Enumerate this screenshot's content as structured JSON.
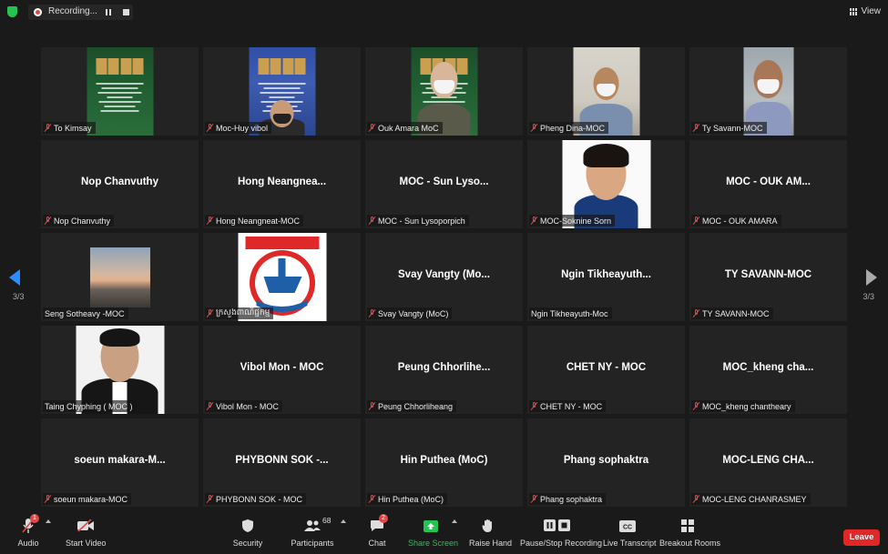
{
  "topbar": {
    "recording_label": "Recording...",
    "view_label": "View"
  },
  "pager": {
    "left": "3/3",
    "right": "3/3"
  },
  "tiles": [
    {
      "label": "To Kimsay",
      "muted": true,
      "type": "video",
      "kind": "banner"
    },
    {
      "label": "Moc-Huy vibol",
      "muted": true,
      "type": "video",
      "kind": "bannerperson"
    },
    {
      "label": "Ouk Amara MoC",
      "muted": true,
      "type": "video",
      "kind": "greenperson"
    },
    {
      "label": "Pheng Dina-MOC",
      "muted": true,
      "type": "video",
      "kind": "office"
    },
    {
      "label": "Ty Savann-MOC",
      "muted": true,
      "type": "video",
      "kind": "wall"
    },
    {
      "big": "Nop Chanvuthy",
      "label": "Nop Chanvuthy",
      "muted": true,
      "type": "name"
    },
    {
      "big": "Hong Neangnea...",
      "label": "Hong Neangneat-MOC",
      "muted": true,
      "type": "name"
    },
    {
      "big": "MOC - Sun Lyso...",
      "label": "MOC - Sun Lysoporpich",
      "muted": true,
      "type": "name"
    },
    {
      "label": "MOC-Soknine Sorn",
      "muted": true,
      "type": "video",
      "kind": "woman"
    },
    {
      "big": "MOC - OUK AM...",
      "label": "MOC - OUK AMARA",
      "muted": true,
      "type": "name"
    },
    {
      "label": "Seng Sotheavy -MOC",
      "muted": false,
      "type": "video",
      "kind": "sunset"
    },
    {
      "label": "ក្រសួងពាណិជ្ជកម្ម",
      "muted": true,
      "type": "video",
      "kind": "logo"
    },
    {
      "big": "Svay Vangty (Mo...",
      "label": "Svay Vangty (MoC)",
      "muted": true,
      "type": "name"
    },
    {
      "big": "Ngin Tikheayuth...",
      "label": "Ngin Tikheayuth-Moc",
      "muted": false,
      "type": "name"
    },
    {
      "big": "TY SAVANN-MOC",
      "label": "TY SAVANN-MOC",
      "muted": true,
      "type": "name"
    },
    {
      "label": "Taing Chyphing ( MOC )",
      "muted": false,
      "type": "video",
      "kind": "portrait"
    },
    {
      "big": "Vibol Mon - MOC",
      "label": "Vibol Mon - MOC",
      "muted": true,
      "type": "name"
    },
    {
      "big": "Peung Chhorlihe...",
      "label": "Peung Chhorliheang",
      "muted": true,
      "type": "name"
    },
    {
      "big": "CHET NY - MOC",
      "label": "CHET NY - MOC",
      "muted": true,
      "type": "name"
    },
    {
      "big": "MOC_kheng cha...",
      "label": "MOC_kheng chantheary",
      "muted": true,
      "type": "name"
    },
    {
      "big": "soeun makara-M...",
      "label": "soeun makara-MOC",
      "muted": true,
      "type": "name"
    },
    {
      "big": "PHYBONN SOK -...",
      "label": "PHYBONN SOK - MOC",
      "muted": true,
      "type": "name"
    },
    {
      "big": "Hin Puthea (MoC)",
      "label": "Hin Puthea (MoC)",
      "muted": true,
      "type": "name"
    },
    {
      "big": "Phang sophaktra",
      "label": "Phang sophaktra",
      "muted": true,
      "type": "name"
    },
    {
      "big": "MOC-LENG CHA...",
      "label": "MOC-LENG CHANRASMEY",
      "muted": true,
      "type": "name"
    }
  ],
  "toolbar": {
    "audio": "Audio",
    "audio_badge": "1",
    "start_video": "Start Video",
    "security": "Security",
    "participants": "Participants",
    "participants_count": "68",
    "chat": "Chat",
    "chat_badge": "2",
    "share_screen": "Share Screen",
    "raise_hand": "Raise Hand",
    "pause_stop_recording": "Pause/Stop Recording",
    "live_transcript": "Live Transcript",
    "breakout_rooms": "Breakout Rooms",
    "leave": "Leave"
  },
  "colors": {
    "accent": "#2d8cff",
    "share_green": "#23c552",
    "leave_red": "#e02828",
    "mute_red": "#e34747"
  }
}
